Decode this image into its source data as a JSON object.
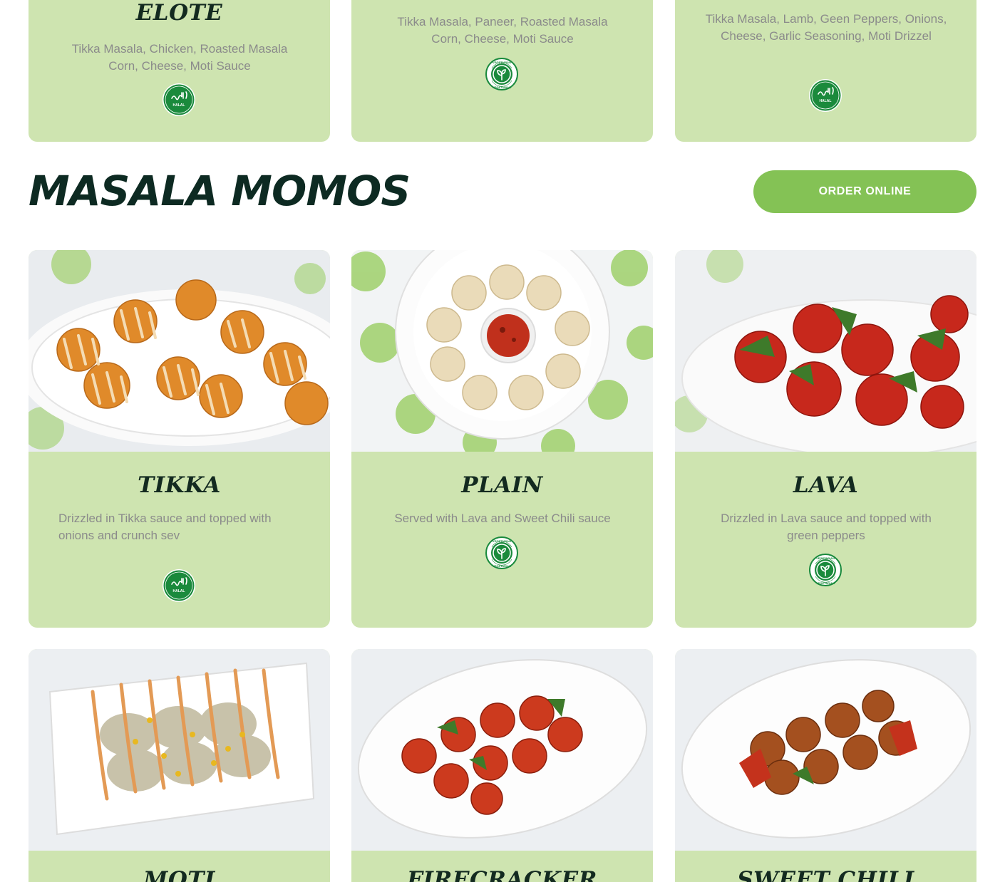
{
  "top_row": [
    {
      "title": "ELOTE",
      "description": "Tikka Masala, Chicken, Roasted Masala Corn, Cheese, Moti Sauce",
      "badge": "halal-icon"
    },
    {
      "title": "",
      "description": "Tikka Masala, Paneer, Roasted Masala Corn, Cheese, Moti Sauce",
      "badge": "vegetarian-icon"
    },
    {
      "title": "",
      "description": "Tikka Masala, Lamb, Geen Peppers, Onions, Cheese, Garlic Seasoning, Moti Drizzel",
      "badge": "halal-icon"
    }
  ],
  "section": {
    "title": "MASALA MOMOS",
    "order_button": "ORDER ONLINE"
  },
  "menu_items": [
    {
      "title": "TIKKA",
      "description": "Drizzled in Tikka sauce and topped with onions and crunch sev",
      "badge": "halal-icon",
      "image": "tikka-momos-photo"
    },
    {
      "title": "PLAIN",
      "description": "Served with Lava and Sweet Chili sauce",
      "badge": "vegetarian-icon",
      "image": "plain-momos-photo"
    },
    {
      "title": "LAVA",
      "description": "Drizzled in Lava sauce and topped with green peppers",
      "badge": "vegetarian-icon",
      "image": "lava-momos-photo"
    },
    {
      "title": "MOTI",
      "image": "moti-momos-photo"
    },
    {
      "title": "FIRECRACKER",
      "image": "firecracker-momos-photo"
    },
    {
      "title": "SWEET CHILI",
      "image": "sweet-chili-momos-photo"
    }
  ],
  "badges": {
    "halal_text_top": "حلال",
    "halal_text_bottom": "HALAL",
    "vegetarian_text": "VEGETARIAN"
  },
  "colors": {
    "card_bg": "#cee4b0",
    "title": "#132a20",
    "section_title": "#0d2a22",
    "button": "#84c255",
    "badge_green": "#1a8a3c",
    "description": "#8b8b8b"
  }
}
